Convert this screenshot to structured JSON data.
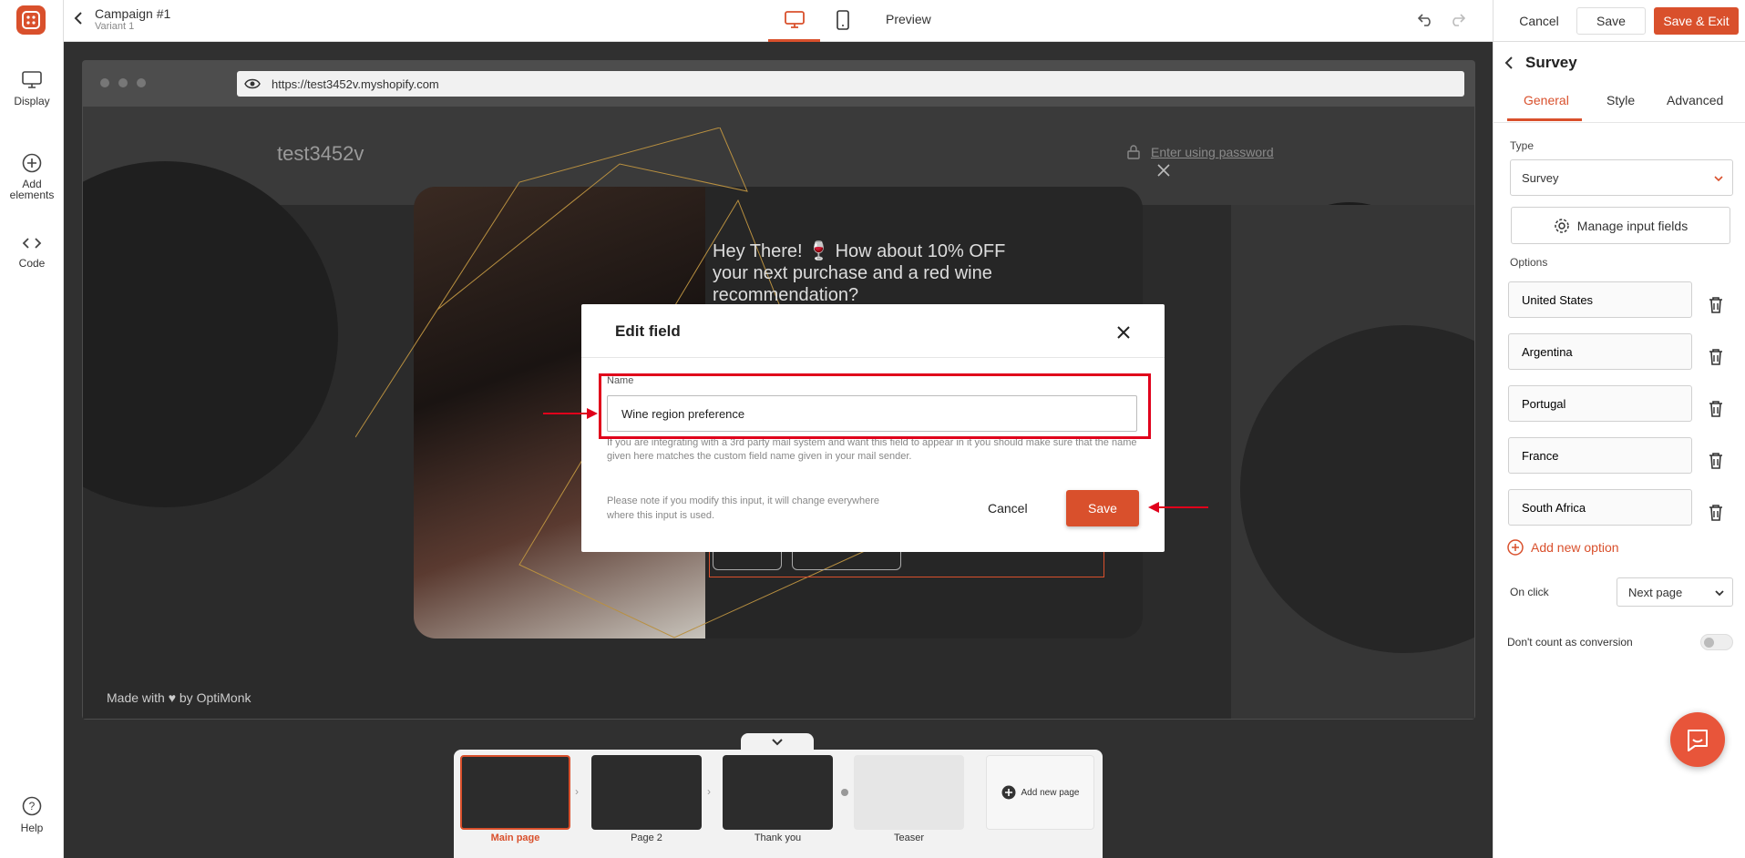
{
  "header": {
    "campaign_title": "Campaign #1",
    "variant": "Variant 1",
    "preview_label": "Preview",
    "cancel_label": "Cancel",
    "save_label": "Save",
    "save_exit_label": "Save & Exit"
  },
  "sidebar": {
    "items": [
      {
        "label": "Display"
      },
      {
        "label": "Add elements"
      },
      {
        "label": "Code"
      }
    ],
    "help_label": "Help"
  },
  "browser": {
    "url": "https://test3452v.myshopify.com"
  },
  "site": {
    "store_name": "test3452v",
    "password_link": "Enter using password",
    "footer_credit": "Made with ♥ by OptiMonk",
    "popup_headline": "Hey There! 🍷 How about 10% OFF your next purchase and a red wine recommendation?"
  },
  "modal": {
    "title": "Edit field",
    "name_label": "Name",
    "name_value": "Wine region preference",
    "help_text": "If you are integrating with a 3rd party mail system and want this field to appear in it you should make sure that the name given here matches the custom field name given in your mail sender.",
    "note_text": "Please note if you modify this input, it will change everywhere where this input is used.",
    "cancel_label": "Cancel",
    "save_label": "Save"
  },
  "pages": {
    "items": [
      {
        "label": "Main page"
      },
      {
        "label": "Page 2"
      },
      {
        "label": "Thank you"
      },
      {
        "label": "Teaser"
      }
    ],
    "add_label": "Add new page"
  },
  "panel": {
    "title": "Survey",
    "tabs": [
      "General",
      "Style",
      "Advanced"
    ],
    "type_label": "Type",
    "type_value": "Survey",
    "manage_label": "Manage input fields",
    "options_label": "Options",
    "options": [
      "United States",
      "Argentina",
      "Portugal",
      "France",
      "South Africa"
    ],
    "add_option_label": "Add new option",
    "on_click_label": "On click",
    "on_click_value": "Next page",
    "no_conversion_label": "Don't count as conversion"
  },
  "colors": {
    "accent": "#d9502c",
    "annotation_red": "#e0001b"
  }
}
